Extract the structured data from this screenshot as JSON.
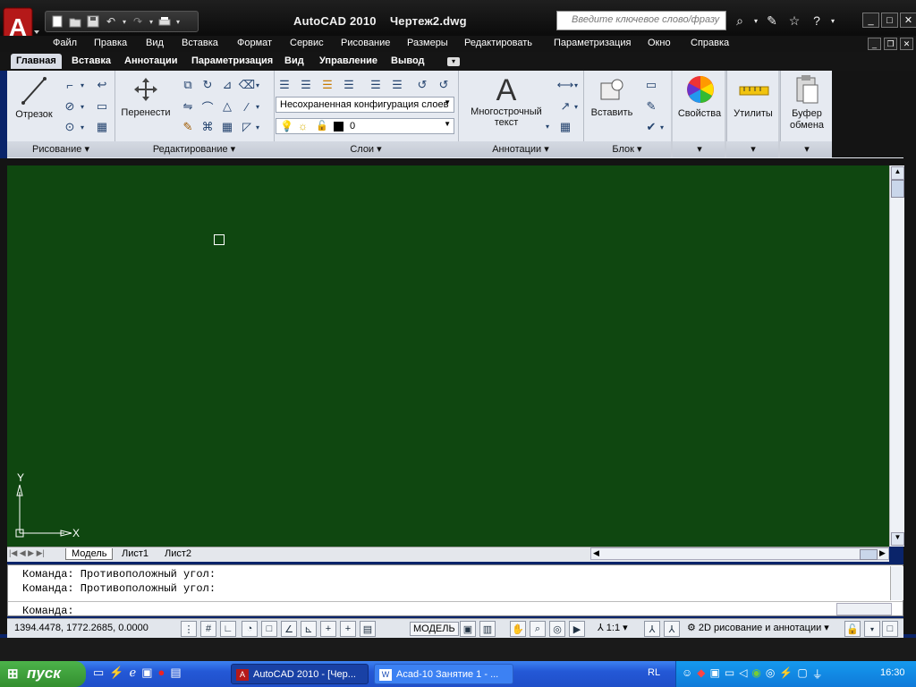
{
  "titlebar": {
    "title": "AutoCAD 2010    Чертеж2.dwg",
    "search_placeholder": "Введите ключевое слово/фразу",
    "qat_icons": [
      "new-icon",
      "open-icon",
      "save-icon",
      "undo-icon",
      "redo-icon",
      "plot-icon"
    ]
  },
  "menubar": {
    "items": [
      "Файл",
      "Правка",
      "Вид",
      "Вставка",
      "Формат",
      "Сервис",
      "Рисование",
      "Размеры",
      "Редактировать",
      "Параметризация",
      "Окно",
      "Справка"
    ]
  },
  "ribbon": {
    "tabs": [
      "Главная",
      "Вставка",
      "Аннотации",
      "Параметризация",
      "Вид",
      "Управление",
      "Вывод"
    ],
    "active_tab": "Главная",
    "panels": {
      "draw": {
        "title": "Рисование",
        "line_label": "Отрезок"
      },
      "modify": {
        "title": "Редактирование",
        "move_label": "Перенести"
      },
      "layers": {
        "title": "Слои",
        "layer_state": "Несохраненная конфигурация слоев",
        "current_layer": "0"
      },
      "annotation": {
        "title": "Аннотации",
        "mtext_label_1": "Многострочный",
        "mtext_label_2": "текст"
      },
      "block": {
        "title": "Блок",
        "insert_label": "Вставить"
      },
      "properties": {
        "label": "Свойства"
      },
      "utilities": {
        "label": "Утилиты"
      },
      "clipboard": {
        "label_1": "Буфер",
        "label_2": "обмена"
      }
    }
  },
  "canvas": {
    "background": "#0f4710",
    "ucs_x": "X",
    "ucs_y": "Y"
  },
  "layout_tabs": [
    "Модель",
    "Лист1",
    "Лист2"
  ],
  "command": {
    "history": [
      "Команда: Противоположный угол:",
      "Команда: Противоположный угол:"
    ],
    "prompt": "Команда:"
  },
  "statusbar": {
    "coords": "1394.4478, 1772.2685, 0.0000",
    "model_label": "МОДЕЛЬ",
    "scale": "1:1",
    "workspace": "2D рисование и аннотации"
  },
  "taskbar": {
    "start_label": "пуск",
    "tasks": [
      "AutoCAD 2010 - [Чер...",
      "Acad-10 Занятие 1 - ..."
    ],
    "language": "RL",
    "clock": "16:30"
  }
}
